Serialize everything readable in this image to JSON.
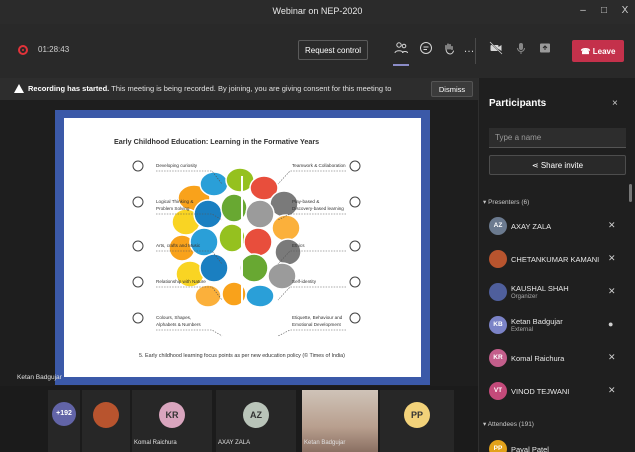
{
  "window": {
    "title": "Webinar on NEP-2020",
    "minimize": "–",
    "maximize": "□",
    "close": "X"
  },
  "toolbar": {
    "timer": "01:28:43",
    "request_control": "Request control",
    "leave": "Leave",
    "icons": [
      "participants-icon",
      "chat-icon",
      "raise-hand-icon",
      "more-icon",
      "camera-off-icon",
      "mic-off-icon",
      "share-tray-icon",
      "phone-icon"
    ]
  },
  "banner": {
    "bold": "Recording has started.",
    "text": "This meeting is being recorded. By joining, you are giving consent for this meeting to be recorded. Priv...",
    "dismiss": "Dismiss"
  },
  "stage": {
    "presenter_label": "Ketan Badgujar"
  },
  "slide": {
    "title": "Early Childhood Education: Learning in the Formative Years",
    "left_labels": [
      "Developing curiosity",
      "Logical Thinking & Problem Solving",
      "Arts, crafts and Music",
      "Relationship with Nature",
      "Colours, Shapes, Alphabets & Numbers"
    ],
    "right_labels": [
      "Teamwork & Collaboration",
      "Play-based & Discovery-based learning",
      "Ethics",
      "Self-identity",
      "Etiquette, Behaviour and Emotional Development"
    ],
    "caption": "5. Early childhood learning focus points as per new education policy (© Times of India)",
    "brain_colors": [
      "#f9a21b",
      "#2a9fd8",
      "#95c11f",
      "#e84e3c",
      "#7a7a7a",
      "#f9d423",
      "#1a7fc1",
      "#68a832",
      "#9b9b9b",
      "#fbb03b"
    ]
  },
  "participants": {
    "title": "Participants",
    "close": "×",
    "search_placeholder": "Type a name",
    "share_invite": "Share invite",
    "presenters_header": "Presenters (6)",
    "attendees_header": "Attendees (191)",
    "presenters": [
      {
        "initials": "AZ",
        "name": "AXAY ZALA",
        "sub": "",
        "color": "#6b7a8f",
        "mic": "✕"
      },
      {
        "initials": "",
        "name": "CHETANKUMAR KAMANI",
        "sub": "",
        "color": "#b8542e",
        "mic": "✕"
      },
      {
        "initials": "",
        "name": "KAUSHAL SHAH",
        "sub": "Organizer",
        "color": "#4f5f9c",
        "mic": "✕"
      },
      {
        "initials": "KB",
        "name": "Ketan Badgujar",
        "sub": "External",
        "color": "#7b83c7",
        "mic": "●"
      },
      {
        "initials": "KR",
        "name": "Komal Raichura",
        "sub": "",
        "color": "#c35e8b",
        "mic": "✕"
      },
      {
        "initials": "VT",
        "name": "VINOD TEJWANI",
        "sub": "",
        "color": "#c44a7a",
        "mic": "✕"
      }
    ],
    "attendees": [
      {
        "initials": "PP",
        "name": "Payal Patel",
        "color": "#e3a21a"
      }
    ]
  },
  "gallery": {
    "tiles": [
      {
        "label": "+192",
        "name": "",
        "color": "#6264a7",
        "type": "overflow"
      },
      {
        "label": "",
        "name": "",
        "color": "#b8542e",
        "type": "photo"
      },
      {
        "label": "KR",
        "name": "Komal Raichura",
        "color": "#d9a5be",
        "type": "avatar"
      },
      {
        "label": "AZ",
        "name": "AXAY ZALA",
        "color": "#b9c4b9",
        "type": "avatar"
      },
      {
        "label": "",
        "name": "Ketan Badgujar",
        "color": "#c9b8a8",
        "type": "video"
      },
      {
        "label": "PP",
        "name": "",
        "color": "#f2d27a",
        "type": "avatar"
      }
    ]
  }
}
